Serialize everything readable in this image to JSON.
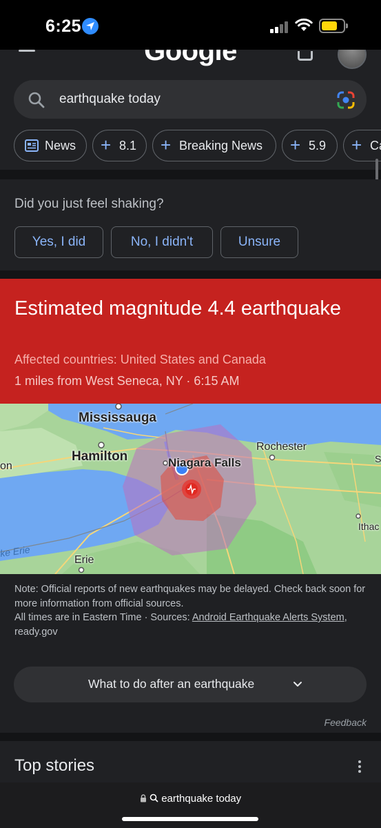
{
  "status_bar": {
    "time": "6:25"
  },
  "google": {
    "logo_text": "Google"
  },
  "search": {
    "query": "earthquake today"
  },
  "chips": [
    {
      "label": "News"
    },
    {
      "label": "8.1"
    },
    {
      "label": "Breaking News"
    },
    {
      "label": "5.9"
    },
    {
      "label": "Ca"
    }
  ],
  "shake_card": {
    "question": "Did you just feel shaking?",
    "answers": [
      "Yes, I did",
      "No, I didn't",
      "Unsure"
    ]
  },
  "alert": {
    "title": "Estimated magnitude 4.4 earthquake",
    "countries": "Affected countries: United States and Canada",
    "location": "1 miles from West Seneca, NY · 6:15 AM",
    "background_color": "#c5221f"
  },
  "map": {
    "labels": {
      "mississauga": "Mississauga",
      "hamilton": "Hamilton",
      "niagara": "Niagara Falls",
      "rochester": "Rochester",
      "erie": "Erie",
      "lake_erie": "ke Erie",
      "ithaca": "Ithac",
      "on": "on",
      "s": "S"
    }
  },
  "note": {
    "text1": "Note: Official reports of new earthquakes may be delayed. Check back soon for more information from official sources.",
    "text2": "All times are in Eastern Time · Sources: ",
    "source_link": "Android Earthquake Alerts System",
    "text3": ", ready.gov"
  },
  "what_to_do": {
    "label": "What to do after an earthquake"
  },
  "feedback": "Feedback",
  "top_stories": {
    "title": "Top stories"
  },
  "browser": {
    "url_text": "earthquake today"
  }
}
